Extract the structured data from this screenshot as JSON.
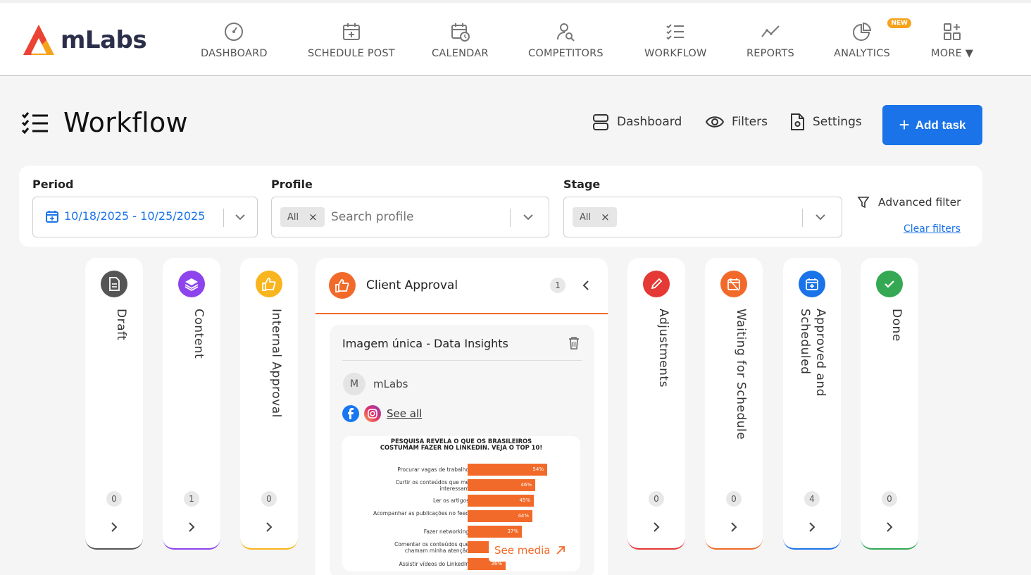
{
  "brand": {
    "name": "mLabs",
    "accent": "#1a73e8",
    "orange": "#f26a2a"
  },
  "nav": {
    "items": [
      {
        "label": "DASHBOARD",
        "icon": "gauge-icon"
      },
      {
        "label": "SCHEDULE POST",
        "icon": "calendar-plus-icon"
      },
      {
        "label": "CALENDAR",
        "icon": "calendar-clock-icon"
      },
      {
        "label": "COMPETITORS",
        "icon": "user-search-icon"
      },
      {
        "label": "WORKFLOW",
        "icon": "checklist-icon"
      },
      {
        "label": "REPORTS",
        "icon": "line-chart-icon"
      },
      {
        "label": "ANALYTICS",
        "icon": "pie-chart-icon",
        "badge": "NEW"
      },
      {
        "label": "MORE ▼",
        "icon": "grid-plus-icon"
      }
    ]
  },
  "page": {
    "title": "Workflow"
  },
  "actions": {
    "dashboard": "Dashboard",
    "filters": "Filters",
    "settings": "Settings",
    "add_task": "Add task"
  },
  "filters": {
    "period": {
      "label": "Period",
      "value": "10/18/2025 - 10/25/2025"
    },
    "profile": {
      "label": "Profile",
      "chip": "All",
      "placeholder": "Search profile"
    },
    "stage": {
      "label": "Stage",
      "chip": "All"
    },
    "advanced": "Advanced filter",
    "clear": "Clear filters"
  },
  "columns": [
    {
      "name": "Draft",
      "count": "0",
      "color": "#555555"
    },
    {
      "name": "Content",
      "count": "1",
      "color": "#8e44ec"
    },
    {
      "name": "Internal Approval",
      "count": "0",
      "color": "#f9b51e"
    },
    {
      "name": "Client Approval",
      "count": "1",
      "color": "#f26a2a"
    },
    {
      "name": "Adjustments",
      "count": "0",
      "color": "#e53935"
    },
    {
      "name": "Waiting for Schedule",
      "count": "0",
      "color": "#f26a2a"
    },
    {
      "name": "Approved and Scheduled",
      "count": "4",
      "color": "#1a73e8"
    },
    {
      "name": "Done",
      "count": "0",
      "color": "#34a853"
    }
  ],
  "card": {
    "title": "Imagem única - Data Insights",
    "avatar": "M",
    "profile": "mLabs",
    "see_all": "See all",
    "see_media": "See media",
    "media": {
      "title_line1": "PESQUISA REVELA O QUE OS BRASILEIROS",
      "title_line2": "COSTUMAM FAZER NO LINKEDIN. VEJA O TOP 10!",
      "rows": [
        {
          "label": "Procurar vagas de trabalho",
          "value": "54%",
          "pct": 54
        },
        {
          "label": "Curtir os conteúdos que me interessam",
          "value": "46%",
          "pct": 46
        },
        {
          "label": "Ler os artigos",
          "value": "45%",
          "pct": 45
        },
        {
          "label": "Acompanhar as publicações no feed",
          "value": "44%",
          "pct": 44
        },
        {
          "label": "Fazer networking",
          "value": "37%",
          "pct": 37
        },
        {
          "label": "Comentar os conteúdos que chamam minha atenção",
          "value": "",
          "pct": 30
        },
        {
          "label": "Assistir vídeos do LinkedIn",
          "value": "26%",
          "pct": 26
        }
      ]
    }
  }
}
